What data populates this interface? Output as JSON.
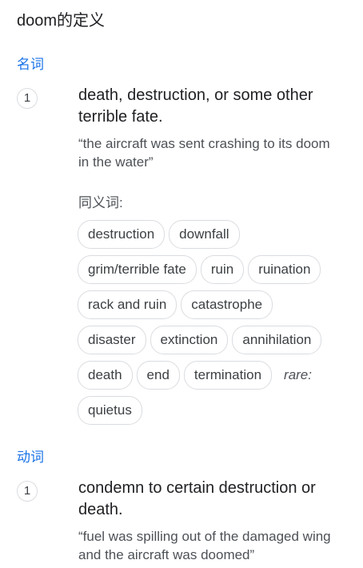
{
  "title": "doom的定义",
  "noun": {
    "pos_label": "名词",
    "sense_number": "1",
    "definition": "death, destruction, or some other terrible fate.",
    "example_line1": "“the aircraft was sent crashing to its doom",
    "example_line2": "in the water”",
    "synonyms_label": "同义词:",
    "synonym_rows": [
      [
        "destruction",
        "downfall"
      ],
      [
        "grim/terrible fate",
        "ruin",
        "ruination"
      ],
      [
        "rack and ruin",
        "catastrophe"
      ],
      [
        "disaster",
        "extinction",
        "annihilation"
      ],
      [
        "death",
        "end",
        "termination"
      ],
      [
        "quietus"
      ]
    ],
    "rare_label": "rare:"
  },
  "verb": {
    "pos_label": "动词",
    "sense_number": "1",
    "definition": "condemn to certain destruction or death.",
    "example_line1": "“fuel was spilling out of the damaged wing",
    "example_line2": "and the aircraft was doomed”"
  }
}
